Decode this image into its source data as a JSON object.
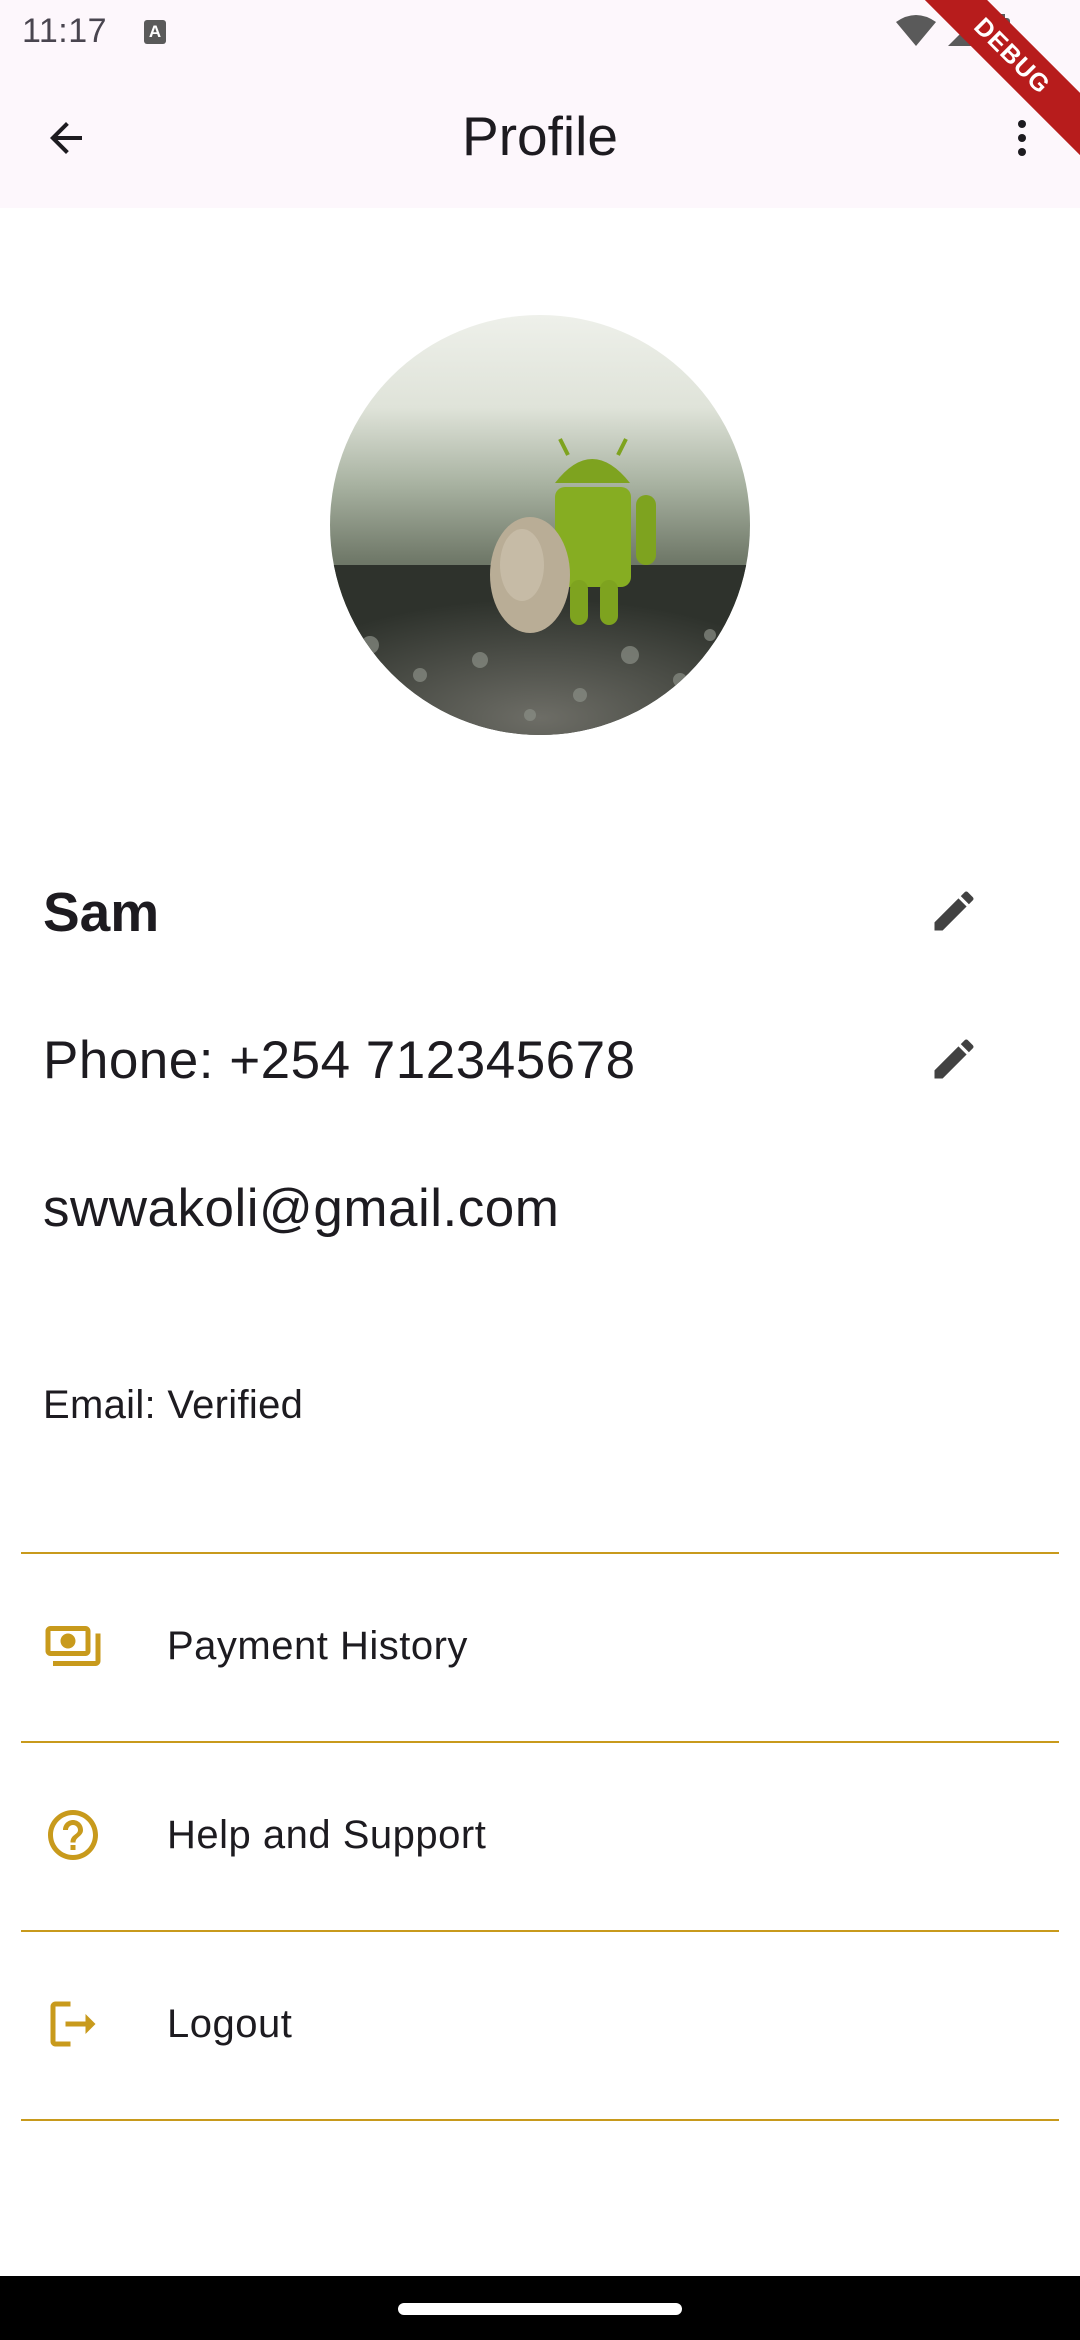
{
  "status_bar": {
    "time": "11:17",
    "a_icon": "A",
    "debug_banner": "DEBUG"
  },
  "app_bar": {
    "title": "Profile",
    "back_icon": "arrow-back-icon",
    "more_icon": "more-vert-icon"
  },
  "profile": {
    "avatar_alt": "android-figure-avatar",
    "name": "Sam",
    "phone": "Phone: +254 712345678",
    "email": "swwakoli@gmail.com",
    "email_status": "Email: Verified"
  },
  "menu": [
    {
      "label": "Payment History",
      "icon": "payments-icon"
    },
    {
      "label": "Help and Support",
      "icon": "help-icon"
    },
    {
      "label": "Logout",
      "icon": "logout-icon"
    }
  ],
  "colors": {
    "accent": "#c89a1c",
    "app_bar_bg": "#fdf7fc",
    "text": "#1d1b20",
    "icon_dark": "#424242"
  }
}
